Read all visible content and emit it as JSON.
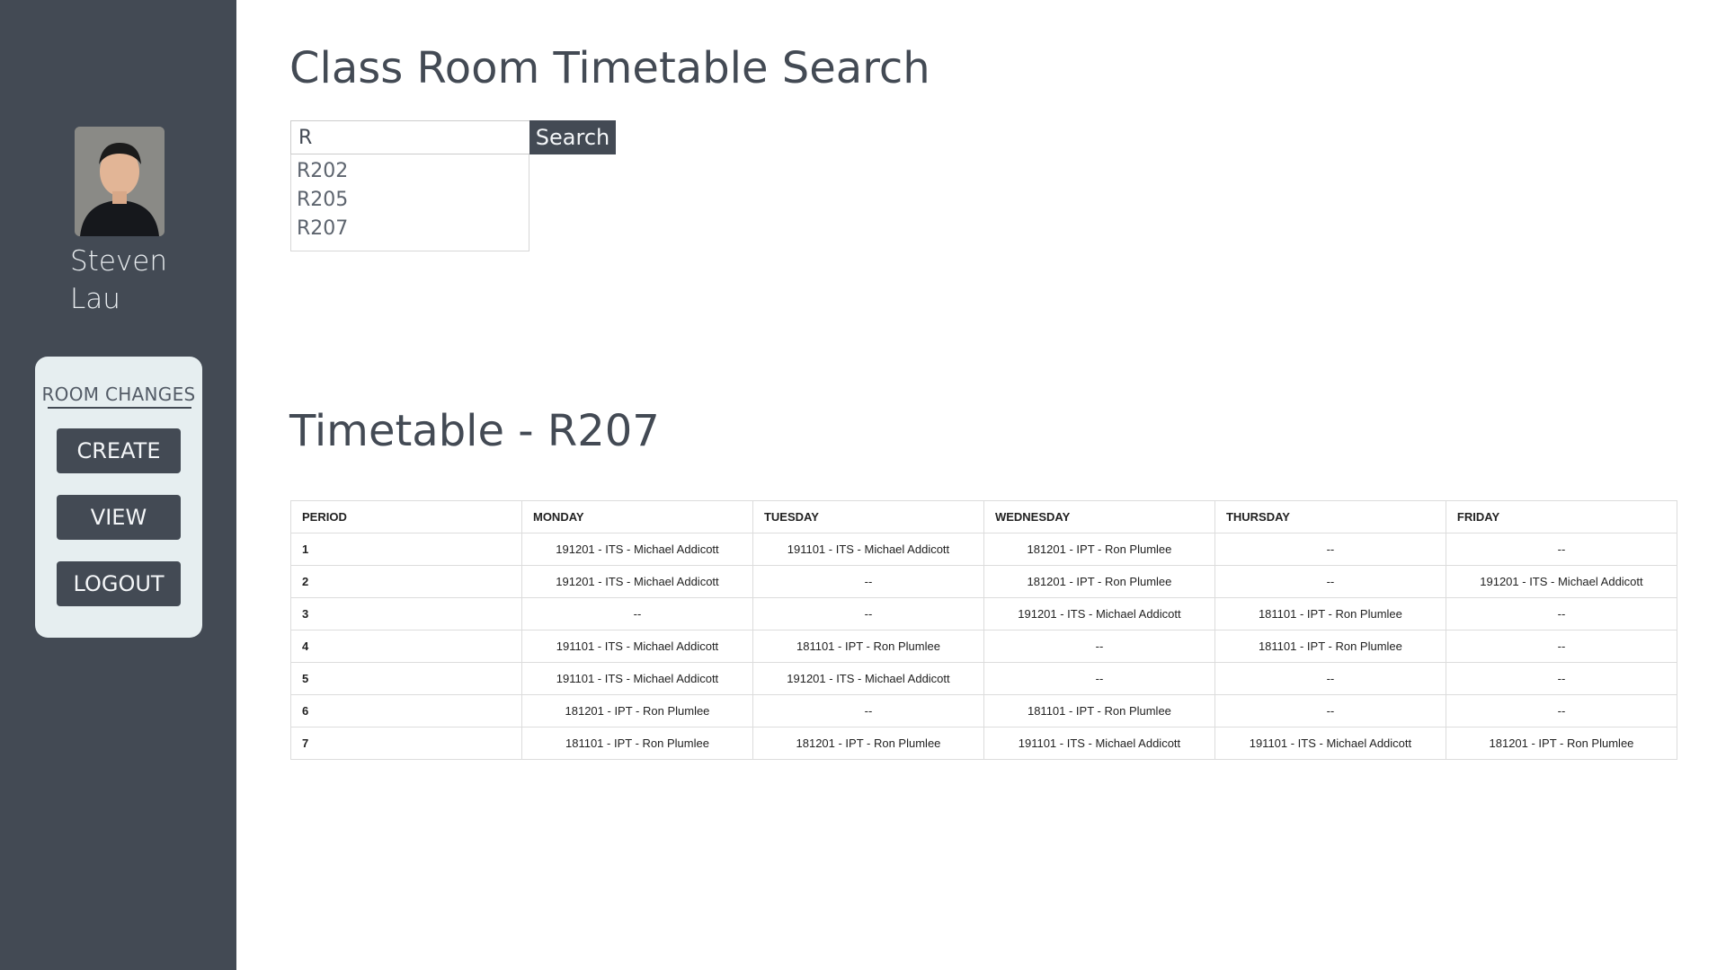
{
  "user": {
    "name": "Steven Lau"
  },
  "sidebar": {
    "section_title": "ROOM CHANGES",
    "buttons": [
      {
        "label": "CREATE"
      },
      {
        "label": "VIEW"
      },
      {
        "label": "LOGOUT"
      }
    ]
  },
  "search": {
    "title": "Class Room Timetable Search",
    "value": "R",
    "button_label": "Search",
    "suggestions": [
      "R202",
      "R205",
      "R207"
    ]
  },
  "timetable": {
    "title": "Timetable - R207",
    "columns": [
      "PERIOD",
      "MONDAY",
      "TUESDAY",
      "WEDNESDAY",
      "THURSDAY",
      "FRIDAY"
    ],
    "rows": [
      [
        "1",
        "191201 - ITS - Michael Addicott",
        "191101 - ITS - Michael Addicott",
        "181201 - IPT - Ron Plumlee",
        "--",
        "--"
      ],
      [
        "2",
        "191201 - ITS - Michael Addicott",
        "--",
        "181201 - IPT - Ron Plumlee",
        "--",
        "191201 - ITS - Michael Addicott"
      ],
      [
        "3",
        "--",
        "--",
        "191201 - ITS - Michael Addicott",
        "181101 - IPT - Ron Plumlee",
        "--"
      ],
      [
        "4",
        "191101 - ITS - Michael Addicott",
        "181101 - IPT - Ron Plumlee",
        "--",
        "181101 - IPT - Ron Plumlee",
        "--"
      ],
      [
        "5",
        "191101 - ITS - Michael Addicott",
        "191201 - ITS - Michael Addicott",
        "--",
        "--",
        "--"
      ],
      [
        "6",
        "181201 - IPT - Ron Plumlee",
        "--",
        "181101 - IPT - Ron Plumlee",
        "--",
        "--"
      ],
      [
        "7",
        "181101 - IPT - Ron Plumlee",
        "181201 - IPT - Ron Plumlee",
        "191101 - ITS - Michael Addicott",
        "191101 - ITS - Michael Addicott",
        "181201 - IPT - Ron Plumlee"
      ]
    ]
  }
}
